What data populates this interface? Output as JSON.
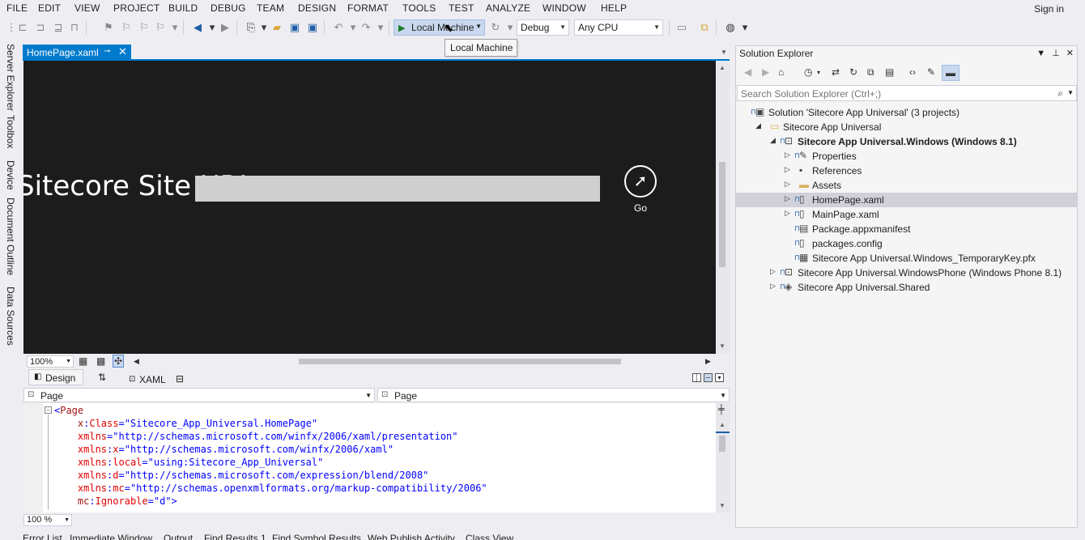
{
  "menu": [
    "FILE",
    "EDIT",
    "VIEW",
    "PROJECT",
    "BUILD",
    "DEBUG",
    "TEAM",
    "DESIGN",
    "FORMAT",
    "TOOLS",
    "TEST",
    "ANALYZE",
    "WINDOW",
    "HELP"
  ],
  "sign_in": "Sign in",
  "toolbar": {
    "run_target": "Local Machine",
    "configuration": "Debug",
    "platform": "Any CPU",
    "tooltip": "Local Machine"
  },
  "left_tabs": [
    "Server Explorer",
    "Toolbox",
    "Device",
    "Document Outline",
    "Data Sources"
  ],
  "document_tab": {
    "name": "HomePage.xaml"
  },
  "designer": {
    "site_label": "Sitecore Site URL:",
    "go_label": "Go",
    "zoom": "100%"
  },
  "split_tabs": {
    "design": "Design",
    "xaml": "XAML"
  },
  "code_nav": {
    "left": "Page",
    "right": "Page"
  },
  "code": [
    {
      "parts": [
        {
          "t": "<",
          "c": "c-punct"
        },
        {
          "t": "Page",
          "c": "c-tag"
        }
      ]
    },
    {
      "parts": [
        {
          "t": "    x",
          "c": "c-ns"
        },
        {
          "t": ":",
          "c": "c-punct"
        },
        {
          "t": "Class",
          "c": "c-attr"
        },
        {
          "t": "=\"Sitecore_App_Universal.HomePage\"",
          "c": "c-val"
        }
      ]
    },
    {
      "parts": [
        {
          "t": "    xmlns",
          "c": "c-attr"
        },
        {
          "t": "=\"http://schemas.microsoft.com/winfx/2006/xaml/presentation\"",
          "c": "c-val"
        }
      ]
    },
    {
      "parts": [
        {
          "t": "    xmlns",
          "c": "c-attr"
        },
        {
          "t": ":",
          "c": "c-punct"
        },
        {
          "t": "x",
          "c": "c-attr"
        },
        {
          "t": "=\"http://schemas.microsoft.com/winfx/2006/xaml\"",
          "c": "c-val"
        }
      ]
    },
    {
      "parts": [
        {
          "t": "    xmlns",
          "c": "c-attr"
        },
        {
          "t": ":",
          "c": "c-punct"
        },
        {
          "t": "local",
          "c": "c-attr"
        },
        {
          "t": "=\"using:Sitecore_App_Universal\"",
          "c": "c-val"
        }
      ]
    },
    {
      "parts": [
        {
          "t": "    xmlns",
          "c": "c-attr"
        },
        {
          "t": ":",
          "c": "c-punct"
        },
        {
          "t": "d",
          "c": "c-attr"
        },
        {
          "t": "=\"http://schemas.microsoft.com/expression/blend/2008\"",
          "c": "c-val"
        }
      ]
    },
    {
      "parts": [
        {
          "t": "    xmlns",
          "c": "c-attr"
        },
        {
          "t": ":",
          "c": "c-punct"
        },
        {
          "t": "mc",
          "c": "c-attr"
        },
        {
          "t": "=\"http://schemas.openxmlformats.org/markup-compatibility/2006\"",
          "c": "c-val"
        }
      ]
    },
    {
      "parts": [
        {
          "t": "    mc",
          "c": "c-ns"
        },
        {
          "t": ":",
          "c": "c-punct"
        },
        {
          "t": "Ignorable",
          "c": "c-attr"
        },
        {
          "t": "=\"d\">",
          "c": "c-val"
        }
      ]
    }
  ],
  "editor_zoom": "100 %",
  "bottom_tabs": [
    "Error List",
    "Immediate Window",
    "Output",
    "Find Results 1",
    "Find Symbol Results",
    "Web Publish Activity",
    "Class View"
  ],
  "solution_explorer": {
    "title": "Solution Explorer",
    "search_placeholder": "Search Solution Explorer (Ctrl+;)",
    "tree": [
      {
        "label": "Solution 'Sitecore App Universal' (3 projects)",
        "level": 0,
        "expander": "",
        "lock": true,
        "icon": "solution-icon",
        "glyph": "▣",
        "bold": false,
        "selected": false
      },
      {
        "label": "Sitecore App Universal",
        "level": 1,
        "expander": "◢",
        "lock": false,
        "icon": "folder-icon",
        "glyph": "▭",
        "bold": false,
        "selected": false
      },
      {
        "label": "Sitecore App Universal.Windows (Windows 8.1)",
        "level": 2,
        "expander": "◢",
        "lock": true,
        "icon": "csharp-project-icon",
        "glyph": "⊡",
        "bold": true,
        "selected": false
      },
      {
        "label": "Properties",
        "level": 3,
        "expander": "▷",
        "lock": true,
        "icon": "wrench-icon",
        "glyph": "✎",
        "bold": false,
        "selected": false
      },
      {
        "label": "References",
        "level": 3,
        "expander": "▷",
        "lock": false,
        "icon": "references-icon",
        "glyph": "▪",
        "bold": false,
        "selected": false
      },
      {
        "label": "Assets",
        "level": 3,
        "expander": "▷",
        "lock": false,
        "icon": "folder-icon",
        "glyph": "▬",
        "bold": false,
        "selected": false
      },
      {
        "label": "HomePage.xaml",
        "level": 3,
        "expander": "▷",
        "lock": true,
        "icon": "xaml-file-icon",
        "glyph": "▯",
        "bold": false,
        "selected": true
      },
      {
        "label": "MainPage.xaml",
        "level": 3,
        "expander": "▷",
        "lock": true,
        "icon": "xaml-file-icon",
        "glyph": "▯",
        "bold": false,
        "selected": false
      },
      {
        "label": "Package.appxmanifest",
        "level": 3,
        "expander": "",
        "lock": true,
        "icon": "manifest-icon",
        "glyph": "▤",
        "bold": false,
        "selected": false
      },
      {
        "label": "packages.config",
        "level": 3,
        "expander": "",
        "lock": true,
        "icon": "config-file-icon",
        "glyph": "▯",
        "bold": false,
        "selected": false
      },
      {
        "label": "Sitecore App Universal.Windows_TemporaryKey.pfx",
        "level": 3,
        "expander": "",
        "lock": true,
        "icon": "certificate-icon",
        "glyph": "▦",
        "bold": false,
        "selected": false
      },
      {
        "label": "Sitecore App Universal.WindowsPhone (Windows Phone 8.1)",
        "level": 2,
        "expander": "▷",
        "lock": true,
        "icon": "csharp-project-icon",
        "glyph": "⊡",
        "bold": false,
        "selected": false
      },
      {
        "label": "Sitecore App Universal.Shared",
        "level": 2,
        "expander": "▷",
        "lock": true,
        "icon": "shared-project-icon",
        "glyph": "◈",
        "bold": false,
        "selected": false
      }
    ]
  }
}
